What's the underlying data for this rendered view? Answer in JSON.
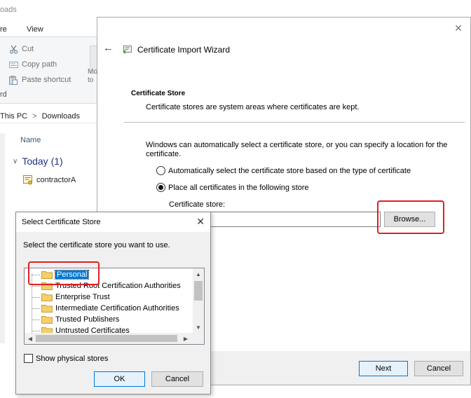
{
  "explorer": {
    "title": "oads",
    "menu": {
      "share": "re",
      "view": "View"
    },
    "ribbon": {
      "cut": "Cut",
      "copy_path": "Copy path",
      "paste_shortcut": "Paste shortcut",
      "move_to": "Mo\nto",
      "group_label": "rd"
    },
    "breadcrumb": {
      "this_pc": "This PC",
      "sep": ">",
      "downloads": "Downloads"
    },
    "column_name": "Name",
    "group": "Today (1)",
    "file": "contractorA"
  },
  "wizard": {
    "title": "Certificate Import Wizard",
    "section_title": "Certificate Store",
    "section_desc": "Certificate stores are system areas where certificates are kept.",
    "intro": "Windows can automatically select a certificate store, or you can specify a location for the certificate.",
    "radio_auto": "Automatically select the certificate store based on the type of certificate",
    "radio_place": "Place all certificates in the following store",
    "store_label": "Certificate store:",
    "store_value": "",
    "browse": "Browse...",
    "next": "Next",
    "cancel": "Cancel"
  },
  "select_store": {
    "title": "Select Certificate Store",
    "instruction": "Select the certificate store you want to use.",
    "stores": [
      "Personal",
      "Trusted Root Certification Authorities",
      "Enterprise Trust",
      "Intermediate Certification Authorities",
      "Trusted Publishers",
      "Untrusted Certificates"
    ],
    "selected_store": "Personal",
    "show_physical": "Show physical stores",
    "ok": "OK",
    "cancel": "Cancel"
  },
  "colors": {
    "accent": "#0078d7",
    "highlight_border": "#e02020",
    "folder": "#f5cf6a"
  }
}
